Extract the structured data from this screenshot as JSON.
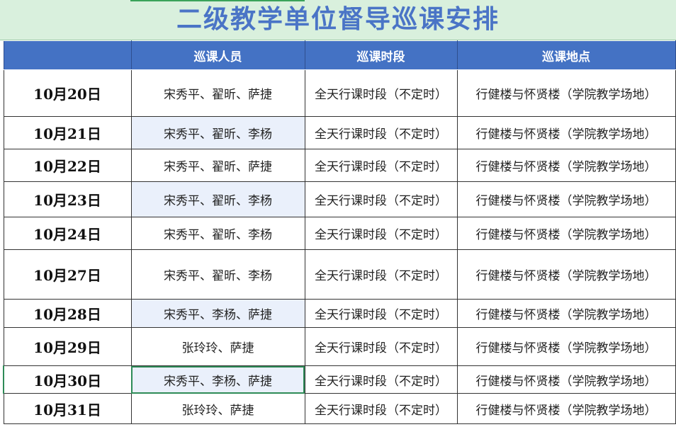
{
  "title": "二级教学单位督导巡课安排",
  "headers": [
    "",
    "巡课人员",
    "巡课时段",
    "巡课地点"
  ],
  "rows": [
    {
      "date": "10月20日",
      "staff": "宋秀平、翟昕、萨捷",
      "period": "全天行课时段（不定时）",
      "place": "行健楼与怀贤楼（学院教学场地）",
      "shaded": false
    },
    {
      "date": "10月21日",
      "staff": "宋秀平、翟昕、李杨",
      "period": "全天行课时段（不定时）",
      "place": "行健楼与怀贤楼（学院教学场地）",
      "shaded": true
    },
    {
      "date": "10月22日",
      "staff": "宋秀平、翟昕、萨捷",
      "period": "全天行课时段（不定时）",
      "place": "行健楼与怀贤楼（学院教学场地）",
      "shaded": false
    },
    {
      "date": "10月23日",
      "staff": "宋秀平、翟昕、李杨",
      "period": "全天行课时段（不定时）",
      "place": "行健楼与怀贤楼（学院教学场地）",
      "shaded": true
    },
    {
      "date": "10月24日",
      "staff": "宋秀平、翟昕、李杨",
      "period": "全天行课时段（不定时）",
      "place": "行健楼与怀贤楼（学院教学场地）",
      "shaded": false
    },
    {
      "date": "10月27日",
      "staff": "宋秀平、翟昕、李杨",
      "period": "全天行课时段（不定时）",
      "place": "行健楼与怀贤楼（学院教学场地）",
      "shaded": false
    },
    {
      "date": "10月28日",
      "staff": "宋秀平、李杨、萨捷",
      "period": "全天行课时段（不定时）",
      "place": "行健楼与怀贤楼（学院教学场地）",
      "shaded": true
    },
    {
      "date": "10月29日",
      "staff": "张玲玲、萨捷",
      "period": "全天行课时段（不定时）",
      "place": "行健楼与怀贤楼（学院教学场地）",
      "shaded": false
    },
    {
      "date": "10月30日",
      "staff": "宋秀平、李杨、萨捷",
      "period": "全天行课时段（不定时）",
      "place": "行健楼与怀贤楼（学院教学场地）",
      "shaded": true,
      "selected": true
    },
    {
      "date": "10月31日",
      "staff": "张玲玲、萨捷",
      "period": "全天行课时段（不定时）",
      "place": "行健楼与怀贤楼（学院教学场地）",
      "shaded": false
    }
  ],
  "colors": {
    "title_bg": "#d9f0dd",
    "title_text": "#4a74c6",
    "header_bg": "#4472c4",
    "header_text": "#ffffff",
    "shade": "#eaf0fb",
    "selection": "#2e8b57"
  }
}
